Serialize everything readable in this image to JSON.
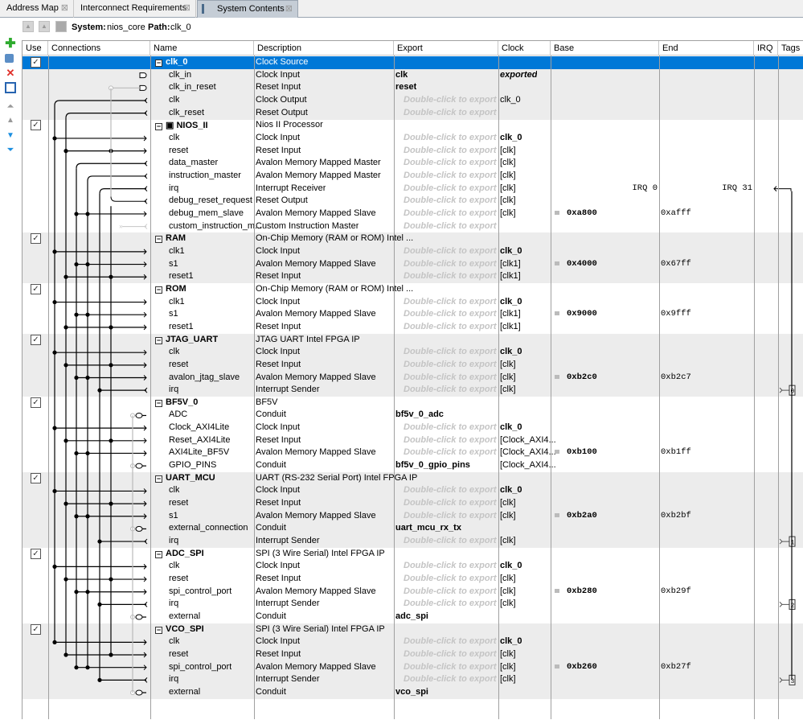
{
  "tabs": [
    {
      "label": "Address Map",
      "active": false
    },
    {
      "label": "Interconnect Requirements",
      "active": false
    },
    {
      "label": "System Contents",
      "active": true
    }
  ],
  "toolbar": {
    "system_label": "System:",
    "system_value": "nios_core",
    "path_label": "Path:",
    "path_value": "clk_0"
  },
  "side_icons": [
    "add-component-icon",
    "new-system-icon",
    "remove-icon",
    "edit-icon",
    "move-to-top-icon",
    "move-up-icon",
    "move-down-icon",
    "move-to-bottom-icon"
  ],
  "columns": [
    "Use",
    "Connections",
    "Name",
    "Description",
    "Export",
    "Clock",
    "Base",
    "End",
    "IRQ",
    "Tags"
  ],
  "export_placeholder": "Double-click to export",
  "irq_labels": {
    "start": "IRQ 0",
    "end": "IRQ 31"
  },
  "colors": {
    "selection": "#0078d7",
    "group_shade": "#ececec"
  },
  "groups": [
    {
      "name": "clk_0",
      "desc": "Clock Source",
      "checked": true,
      "selected": true,
      "rows": [
        {
          "name": "clk_in",
          "desc": "Clock Input",
          "export": "clk",
          "clock": "exported",
          "clock_style": "bi",
          "conn": "src_in"
        },
        {
          "name": "clk_in_reset",
          "desc": "Reset Input",
          "export": "reset",
          "conn": "src_in_rst"
        },
        {
          "name": "clk",
          "desc": "Clock Output",
          "export": null,
          "clock": "clk_0",
          "conn": "clk_out"
        },
        {
          "name": "clk_reset",
          "desc": "Reset Output",
          "export": null,
          "conn": "rst_out"
        }
      ]
    },
    {
      "name": "NIOS_II",
      "desc": "Nios II Processor",
      "checked": true,
      "icon": "cpu-icon",
      "rows": [
        {
          "name": "clk",
          "desc": "Clock Input",
          "export": null,
          "clock": "clk_0",
          "clock_style": "b",
          "conn": "clk_in"
        },
        {
          "name": "reset",
          "desc": "Reset Input",
          "export": null,
          "clock": "[clk]",
          "conn": "rst_in"
        },
        {
          "name": "data_master",
          "desc": "Avalon Memory Mapped Master",
          "export": null,
          "clock": "[clk]",
          "conn": "m_d"
        },
        {
          "name": "instruction_master",
          "desc": "Avalon Memory Mapped Master",
          "export": null,
          "clock": "[clk]",
          "conn": "m_i"
        },
        {
          "name": "irq",
          "desc": "Interrupt Receiver",
          "export": null,
          "clock": "[clk]",
          "conn": "irq_recv",
          "irq_range": true
        },
        {
          "name": "debug_reset_request",
          "desc": "Reset Output",
          "export": null,
          "clock": "[clk]",
          "conn": "dbg_rst"
        },
        {
          "name": "debug_mem_slave",
          "desc": "Avalon Memory Mapped Slave",
          "export": null,
          "clock": "[clk]",
          "base": "0xa800",
          "end": "0xafff",
          "conn": "slave"
        },
        {
          "name": "custom_instruction_m...",
          "desc": "Custom Instruction Master",
          "export": null,
          "conn": "custom"
        }
      ]
    },
    {
      "name": "RAM",
      "desc": "On-Chip Memory (RAM or ROM) Intel ...",
      "checked": true,
      "rows": [
        {
          "name": "clk1",
          "desc": "Clock Input",
          "export": null,
          "clock": "clk_0",
          "clock_style": "b",
          "conn": "clk_in"
        },
        {
          "name": "s1",
          "desc": "Avalon Memory Mapped Slave",
          "export": null,
          "clock": "[clk1]",
          "base": "0x4000",
          "end": "0x67ff",
          "conn": "slave"
        },
        {
          "name": "reset1",
          "desc": "Reset Input",
          "export": null,
          "clock": "[clk1]",
          "conn": "rst_in"
        }
      ]
    },
    {
      "name": "ROM",
      "desc": "On-Chip Memory (RAM or ROM) Intel ...",
      "checked": true,
      "rows": [
        {
          "name": "clk1",
          "desc": "Clock Input",
          "export": null,
          "clock": "clk_0",
          "clock_style": "b",
          "conn": "clk_in"
        },
        {
          "name": "s1",
          "desc": "Avalon Memory Mapped Slave",
          "export": null,
          "clock": "[clk1]",
          "base": "0x9000",
          "end": "0x9fff",
          "conn": "slave"
        },
        {
          "name": "reset1",
          "desc": "Reset Input",
          "export": null,
          "clock": "[clk1]",
          "conn": "rst_in"
        }
      ]
    },
    {
      "name": "JTAG_UART",
      "desc": "JTAG UART Intel FPGA IP",
      "checked": true,
      "rows": [
        {
          "name": "clk",
          "desc": "Clock Input",
          "export": null,
          "clock": "clk_0",
          "clock_style": "b",
          "conn": "clk_in"
        },
        {
          "name": "reset",
          "desc": "Reset Input",
          "export": null,
          "clock": "[clk]",
          "conn": "rst_in"
        },
        {
          "name": "avalon_jtag_slave",
          "desc": "Avalon Memory Mapped Slave",
          "export": null,
          "clock": "[clk]",
          "base": "0xb2c0",
          "end": "0xb2c7",
          "conn": "slave"
        },
        {
          "name": "irq",
          "desc": "Interrupt Sender",
          "export": null,
          "clock": "[clk]",
          "irq": "0",
          "conn": "irq_send"
        }
      ]
    },
    {
      "name": "BF5V_0",
      "desc": "BF5V",
      "checked": true,
      "rows": [
        {
          "name": "ADC",
          "desc": "Conduit",
          "export": "bf5v_0_adc",
          "conn": "conduit"
        },
        {
          "name": "Clock_AXI4Lite",
          "desc": "Clock Input",
          "export": null,
          "clock": "clk_0",
          "clock_style": "b",
          "conn": "clk_in"
        },
        {
          "name": "Reset_AXI4Lite",
          "desc": "Reset Input",
          "export": null,
          "clock": "[Clock_AXI4...",
          "conn": "rst_in"
        },
        {
          "name": "AXI4Lite_BF5V",
          "desc": "Avalon Memory Mapped Slave",
          "export": null,
          "clock": "[Clock_AXI4...",
          "base": "0xb100",
          "end": "0xb1ff",
          "conn": "slave"
        },
        {
          "name": "GPIO_PINS",
          "desc": "Conduit",
          "export": "bf5v_0_gpio_pins",
          "clock": "[Clock_AXI4...",
          "conn": "conduit"
        }
      ]
    },
    {
      "name": "UART_MCU",
      "desc": "UART (RS-232 Serial Port) Intel FPGA IP",
      "checked": true,
      "rows": [
        {
          "name": "clk",
          "desc": "Clock Input",
          "export": null,
          "clock": "clk_0",
          "clock_style": "b",
          "conn": "clk_in"
        },
        {
          "name": "reset",
          "desc": "Reset Input",
          "export": null,
          "clock": "[clk]",
          "conn": "rst_in"
        },
        {
          "name": "s1",
          "desc": "Avalon Memory Mapped Slave",
          "export": null,
          "clock": "[clk]",
          "base": "0xb2a0",
          "end": "0xb2bf",
          "conn": "slave"
        },
        {
          "name": "external_connection",
          "desc": "Conduit",
          "export": "uart_mcu_rx_tx",
          "conn": "conduit"
        },
        {
          "name": "irq",
          "desc": "Interrupt Sender",
          "export": null,
          "clock": "[clk]",
          "irq": "1",
          "conn": "irq_send"
        }
      ]
    },
    {
      "name": "ADC_SPI",
      "desc": "SPI (3 Wire Serial) Intel FPGA IP",
      "checked": true,
      "rows": [
        {
          "name": "clk",
          "desc": "Clock Input",
          "export": null,
          "clock": "clk_0",
          "clock_style": "b",
          "conn": "clk_in"
        },
        {
          "name": "reset",
          "desc": "Reset Input",
          "export": null,
          "clock": "[clk]",
          "conn": "rst_in"
        },
        {
          "name": "spi_control_port",
          "desc": "Avalon Memory Mapped Slave",
          "export": null,
          "clock": "[clk]",
          "base": "0xb280",
          "end": "0xb29f",
          "conn": "slave"
        },
        {
          "name": "irq",
          "desc": "Interrupt Sender",
          "export": null,
          "clock": "[clk]",
          "irq": "2",
          "conn": "irq_send"
        },
        {
          "name": "external",
          "desc": "Conduit",
          "export": "adc_spi",
          "conn": "conduit"
        }
      ]
    },
    {
      "name": "VCO_SPI",
      "desc": "SPI (3 Wire Serial) Intel FPGA IP",
      "checked": true,
      "rows": [
        {
          "name": "clk",
          "desc": "Clock Input",
          "export": null,
          "clock": "clk_0",
          "clock_style": "b",
          "conn": "clk_in"
        },
        {
          "name": "reset",
          "desc": "Reset Input",
          "export": null,
          "clock": "[clk]",
          "conn": "rst_in"
        },
        {
          "name": "spi_control_port",
          "desc": "Avalon Memory Mapped Slave",
          "export": null,
          "clock": "[clk]",
          "base": "0xb260",
          "end": "0xb27f",
          "conn": "slave"
        },
        {
          "name": "irq",
          "desc": "Interrupt Sender",
          "export": null,
          "clock": "[clk]",
          "irq": "3",
          "conn": "irq_send"
        },
        {
          "name": "external",
          "desc": "Conduit",
          "export": "vco_spi",
          "conn": "conduit"
        }
      ]
    }
  ]
}
